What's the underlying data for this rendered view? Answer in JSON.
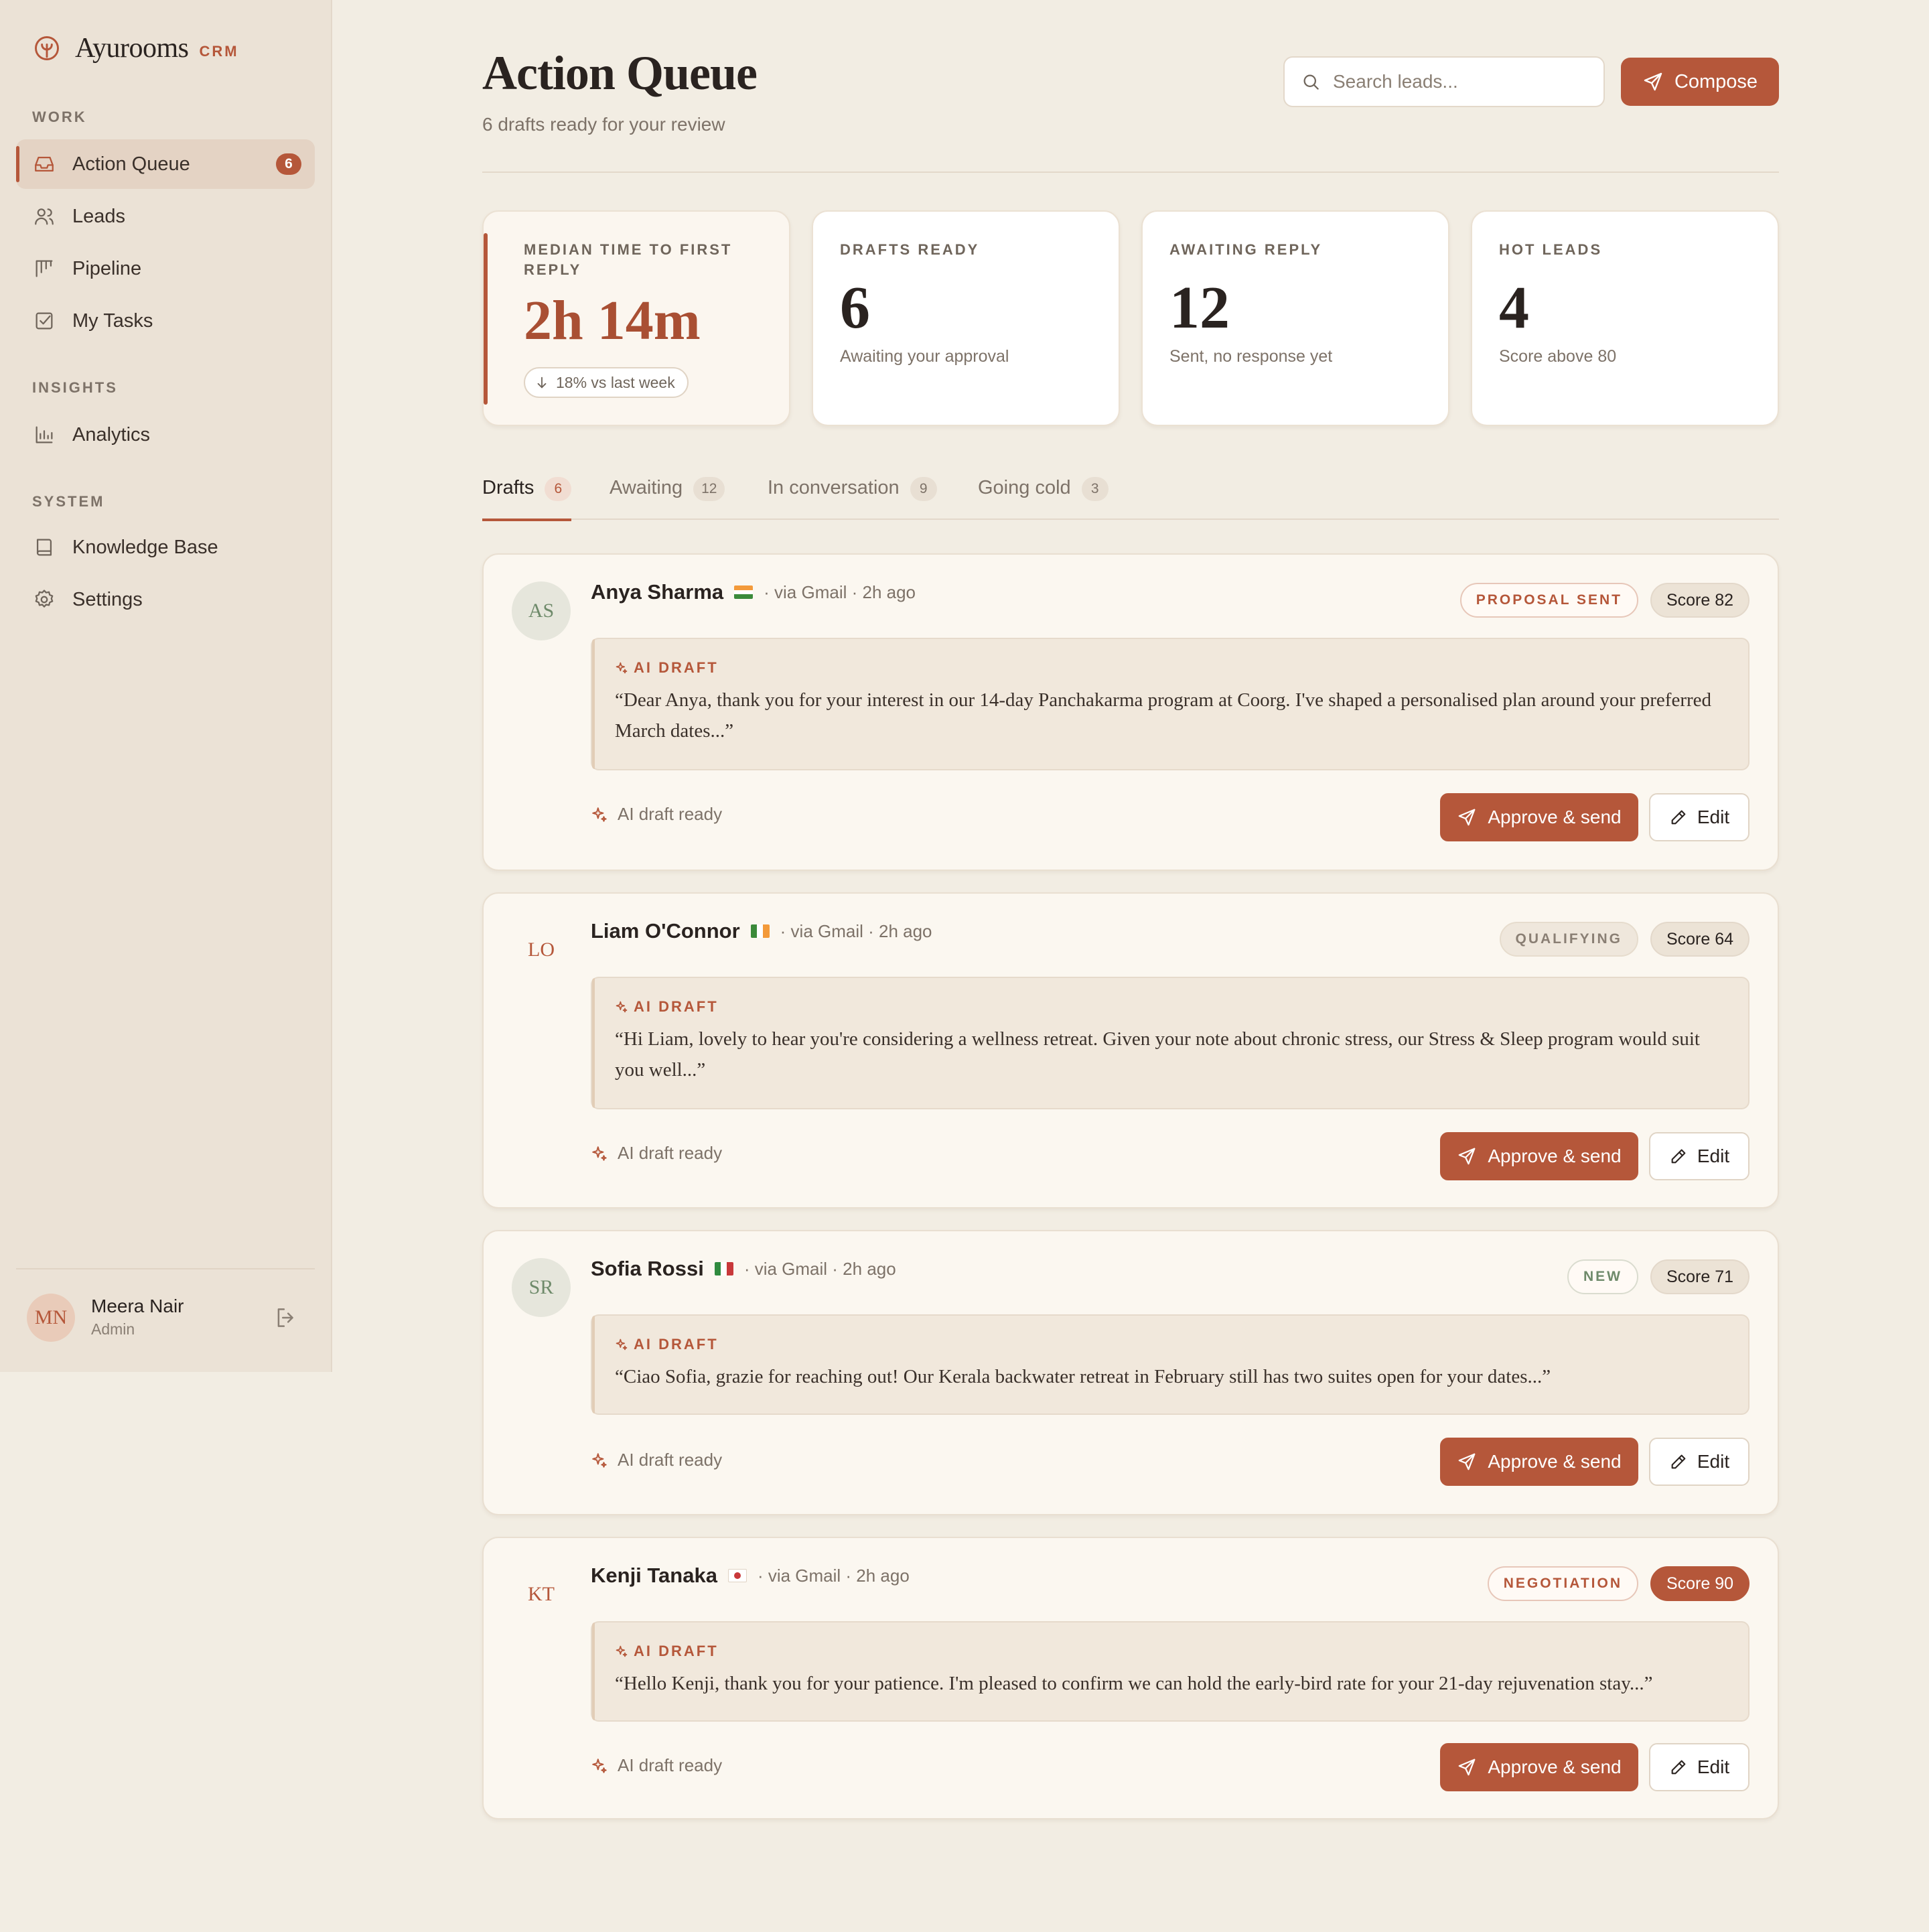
{
  "brand": {
    "name": "Ayurooms",
    "tag": "CRM"
  },
  "sidebar": {
    "sections": {
      "work": "WORK",
      "insights": "INSIGHTS",
      "system": "SYSTEM"
    },
    "items": [
      {
        "label": "Action Queue",
        "icon": "inbox-icon",
        "badge": "6",
        "active": true
      },
      {
        "label": "Leads",
        "icon": "users-icon"
      },
      {
        "label": "Pipeline",
        "icon": "kanban-icon"
      },
      {
        "label": "My Tasks",
        "icon": "checkbox-icon"
      },
      {
        "label": "Analytics",
        "icon": "bar-chart-icon"
      },
      {
        "label": "Knowledge Base",
        "icon": "book-icon"
      },
      {
        "label": "Settings",
        "icon": "gear-icon"
      }
    ],
    "user": {
      "initials": "MN",
      "name": "Meera Nair",
      "role": "Admin"
    }
  },
  "header": {
    "title": "Action Queue",
    "subtitle": "6 drafts ready for your review",
    "search_placeholder": "Search leads...",
    "compose_label": "Compose"
  },
  "stats": [
    {
      "label": "MEDIAN TIME TO FIRST REPLY",
      "value": "2h 14m",
      "trend": "18% vs last week"
    },
    {
      "label": "DRAFTS READY",
      "value": "6",
      "sub": "Awaiting your approval"
    },
    {
      "label": "AWAITING REPLY",
      "value": "12",
      "sub": "Sent, no response yet"
    },
    {
      "label": "HOT LEADS",
      "value": "4",
      "sub": "Score above 80"
    }
  ],
  "tabs": [
    {
      "label": "Drafts",
      "count": "6",
      "active": true
    },
    {
      "label": "Awaiting",
      "count": "12"
    },
    {
      "label": "In conversation",
      "count": "9"
    },
    {
      "label": "Going cold",
      "count": "3"
    }
  ],
  "leads": [
    {
      "initials": "AS",
      "name": "Anya Sharma",
      "meta": "· via Gmail · 2h ago",
      "status": "PROPOSAL SENT",
      "score": "Score 82",
      "draft_label": "AI DRAFT",
      "draft": "“Dear Anya, thank you for your interest in our 14-day Panchakarma program at Coorg. I've shaped a personalised plan around your preferred March dates...”",
      "ready": "AI draft ready",
      "approve": "Approve & send",
      "edit": "Edit"
    },
    {
      "initials": "LO",
      "name": "Liam O'Connor",
      "meta": "· via Gmail · 2h ago",
      "status": "QUALIFYING",
      "score": "Score 64",
      "draft_label": "AI DRAFT",
      "draft": "“Hi Liam, lovely to hear you're considering a wellness retreat. Given your note about chronic stress, our Stress & Sleep program would suit you well...”",
      "ready": "AI draft ready",
      "approve": "Approve & send",
      "edit": "Edit"
    },
    {
      "initials": "SR",
      "name": "Sofia Rossi",
      "meta": "· via Gmail · 2h ago",
      "status": "NEW",
      "score": "Score 71",
      "draft_label": "AI DRAFT",
      "draft": "“Ciao Sofia, grazie for reaching out! Our Kerala backwater retreat in February still has two suites open for your dates...”",
      "ready": "AI draft ready",
      "approve": "Approve & send",
      "edit": "Edit"
    },
    {
      "initials": "KT",
      "name": "Kenji Tanaka",
      "meta": "· via Gmail · 2h ago",
      "status": "NEGOTIATION",
      "score": "Score 90",
      "draft_label": "AI DRAFT",
      "draft": "“Hello Kenji, thank you for your patience. I'm pleased to confirm we can hold the early-bird rate for your 21-day rejuvenation stay...”",
      "ready": "AI draft ready",
      "approve": "Approve & send",
      "edit": "Edit"
    }
  ],
  "colors": {
    "accent": "#b5573a",
    "background": "#f2ede3",
    "sidebar": "#ebe2d6"
  }
}
